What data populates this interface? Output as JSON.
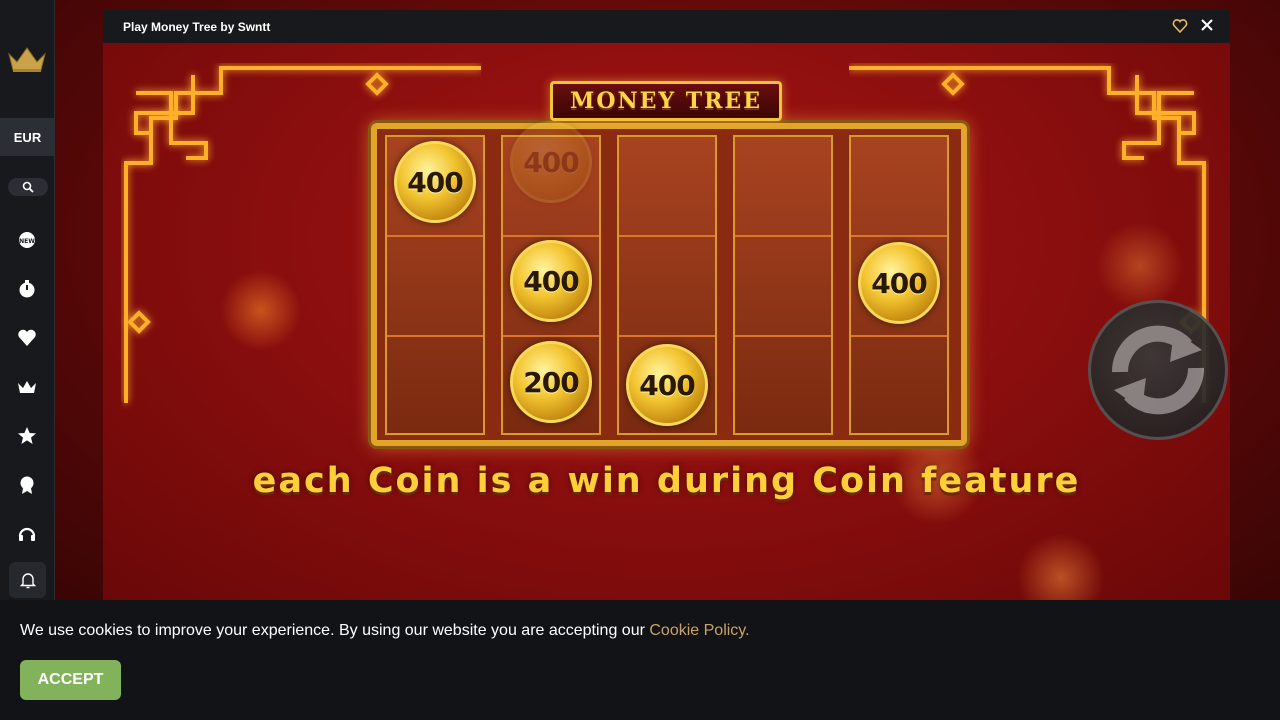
{
  "sidebar": {
    "currency": "EUR",
    "icons": [
      "crown-logo-icon",
      "search-icon",
      "new-games-icon",
      "stopwatch-icon",
      "heart-icon",
      "crown-icon",
      "star-icon",
      "award-icon",
      "headset-icon",
      "bell-icon"
    ]
  },
  "game": {
    "title": "Play Money Tree by Swntt",
    "logo": "MONEY TREE",
    "feature_text": "each Coin is a win during Coin feature",
    "coins": [
      {
        "reel": 1,
        "row": 1,
        "value": "400",
        "ghost": false
      },
      {
        "reel": 2,
        "row": 1,
        "value": "400",
        "ghost": true
      },
      {
        "reel": 2,
        "row": 2,
        "value": "400",
        "ghost": false
      },
      {
        "reel": 2,
        "row": 3,
        "value": "200",
        "ghost": false
      },
      {
        "reel": 3,
        "row": 3,
        "value": "400",
        "ghost": false
      },
      {
        "reel": 5,
        "row": 2,
        "value": "400",
        "ghost": false
      }
    ]
  },
  "cookie": {
    "text": "We use cookies to improve your experience. By using our website you are accepting our ",
    "link_text": "Cookie Policy.",
    "accept_label": "ACCEPT"
  },
  "colors": {
    "accent_green": "#82b35b",
    "link_gold": "#c9a26b",
    "gold": "#ffcf3a",
    "background_red": "#8a0e0e"
  }
}
